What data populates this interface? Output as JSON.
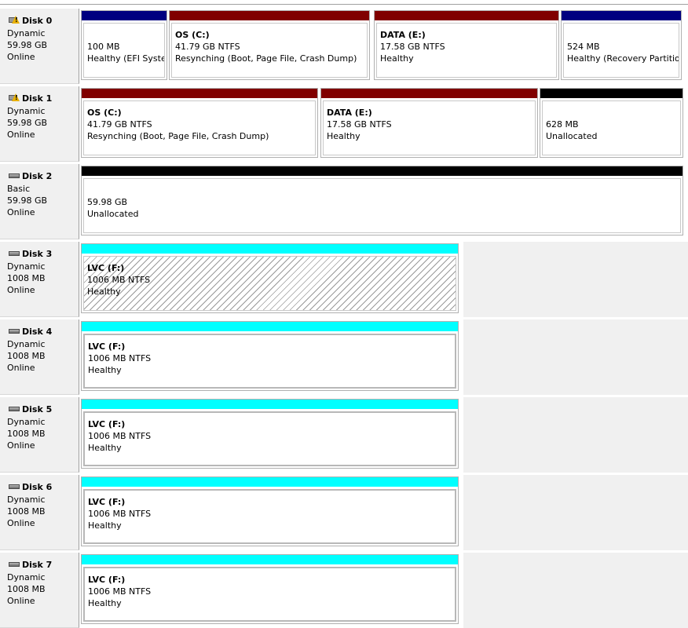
{
  "colors": {
    "primary": "#000080",
    "simple": "#800000",
    "unallocated": "#000000",
    "mirrored": "#00ffff"
  },
  "disks": [
    {
      "name": "Disk 0",
      "icon": "disk-warning-icon",
      "type": "Dynamic",
      "size": "59.98 GB",
      "status": "Online",
      "volumes": [
        {
          "name": "",
          "line1": "100 MB",
          "line2": "Healthy (EFI System Partition)",
          "color": "primary"
        },
        {
          "name": "OS  (C:)",
          "line1": "41.79 GB NTFS",
          "line2": "Resynching (Boot, Page File, Crash Dump)",
          "color": "simple"
        },
        {
          "name": "DATA  (E:)",
          "line1": "17.58 GB NTFS",
          "line2": "Healthy",
          "color": "simple"
        },
        {
          "name": "",
          "line1": "524 MB",
          "line2": "Healthy (Recovery Partition)",
          "color": "primary"
        }
      ]
    },
    {
      "name": "Disk 1",
      "icon": "disk-warning-icon",
      "type": "Dynamic",
      "size": "59.98 GB",
      "status": "Online",
      "volumes": [
        {
          "name": "OS  (C:)",
          "line1": "41.79 GB NTFS",
          "line2": "Resynching (Boot, Page File, Crash Dump)",
          "color": "simple"
        },
        {
          "name": "DATA  (E:)",
          "line1": "17.58 GB NTFS",
          "line2": "Healthy",
          "color": "simple"
        },
        {
          "name": "",
          "line1": "628 MB",
          "line2": "Unallocated",
          "color": "unallocated"
        }
      ]
    },
    {
      "name": "Disk 2",
      "icon": "disk-icon",
      "type": "Basic",
      "size": "59.98 GB",
      "status": "Online",
      "volumes": [
        {
          "name": "",
          "line1": "59.98 GB",
          "line2": "Unallocated",
          "color": "unallocated"
        }
      ]
    },
    {
      "name": "Disk 3",
      "icon": "disk-icon",
      "type": "Dynamic",
      "size": "1008 MB",
      "status": "Online",
      "volumes": [
        {
          "name": "LVC  (F:)",
          "line1": "1006 MB NTFS",
          "line2": "Healthy",
          "color": "mirrored",
          "selected": true
        }
      ]
    },
    {
      "name": "Disk 4",
      "icon": "disk-icon",
      "type": "Dynamic",
      "size": "1008 MB",
      "status": "Online",
      "volumes": [
        {
          "name": "LVC  (F:)",
          "line1": "1006 MB NTFS",
          "line2": "Healthy",
          "color": "mirrored"
        }
      ]
    },
    {
      "name": "Disk 5",
      "icon": "disk-icon",
      "type": "Dynamic",
      "size": "1008 MB",
      "status": "Online",
      "volumes": [
        {
          "name": "LVC  (F:)",
          "line1": "1006 MB NTFS",
          "line2": "Healthy",
          "color": "mirrored"
        }
      ]
    },
    {
      "name": "Disk 6",
      "icon": "disk-icon",
      "type": "Dynamic",
      "size": "1008 MB",
      "status": "Online",
      "volumes": [
        {
          "name": "LVC  (F:)",
          "line1": "1006 MB NTFS",
          "line2": "Healthy",
          "color": "mirrored"
        }
      ]
    },
    {
      "name": "Disk 7",
      "icon": "disk-icon",
      "type": "Dynamic",
      "size": "1008 MB",
      "status": "Online",
      "volumes": [
        {
          "name": "LVC  (F:)",
          "line1": "1006 MB NTFS",
          "line2": "Healthy",
          "color": "mirrored"
        }
      ]
    }
  ]
}
